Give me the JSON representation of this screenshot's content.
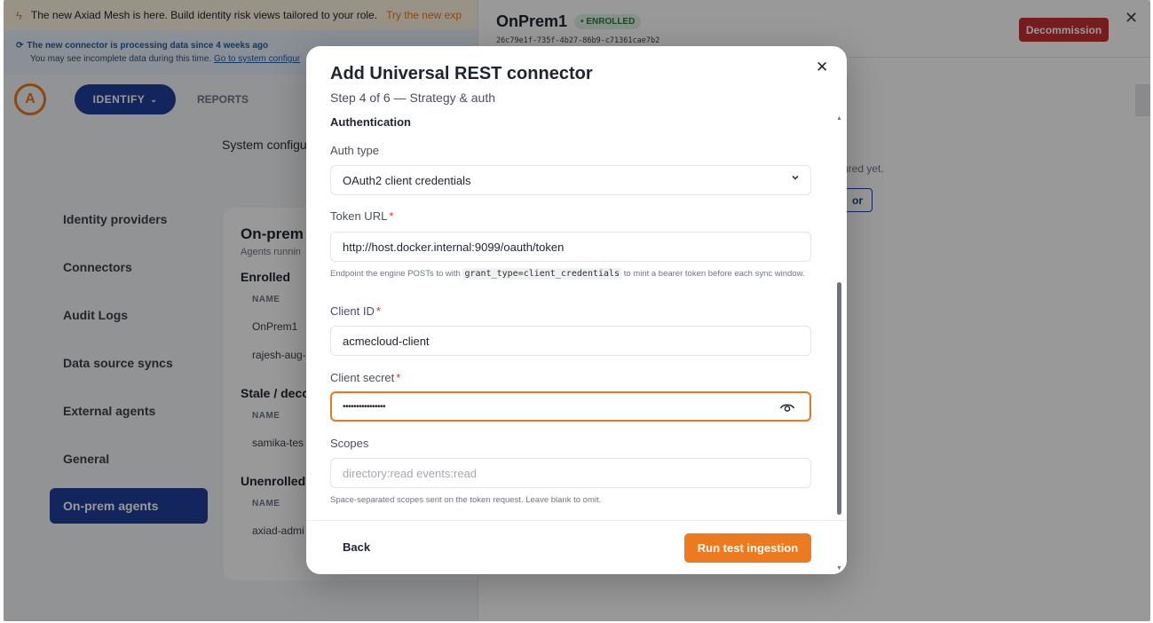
{
  "banner": {
    "text": "The new Axiad Mesh is here. Build identity risk views tailored to your role.",
    "link": "Try the new exp"
  },
  "notice": {
    "line1": "The new connector is processing data since 4 weeks ago",
    "line2": "You may see incomplete data during this time.",
    "link": "Go to system configur"
  },
  "nav": {
    "logo": "A",
    "identify": "IDENTIFY",
    "reports": "REPORTS"
  },
  "system_config": "System configu",
  "sidebar": {
    "items": [
      {
        "label": "Identity providers"
      },
      {
        "label": "Connectors"
      },
      {
        "label": "Audit Logs"
      },
      {
        "label": "Data source syncs"
      },
      {
        "label": "External agents"
      },
      {
        "label": "General"
      },
      {
        "label": "On-prem agents"
      }
    ]
  },
  "onprem": {
    "title": "On-prem",
    "subtitle": "Agents runnin",
    "enrolled": "Enrolled",
    "name_col": "NAME",
    "enrolled_rows": [
      "OnPrem1",
      "rajesh-aug-"
    ],
    "stale": "Stale / deco",
    "stale_rows": [
      "samika-tes"
    ],
    "unenrolled": "Unenrolled",
    "unenrolled_rows": [
      "axiad-admi"
    ]
  },
  "detail": {
    "title": "OnPrem1",
    "badge": "• ENROLLED",
    "id": "26c79e1f-735f-4b27-86b9-c71361cae7b2",
    "decommission": "Decommission",
    "empty_text": "ured yet.",
    "add_btn": "or"
  },
  "modal": {
    "title": "Add Universal REST connector",
    "step": "Step 4 of 6 — Strategy & auth",
    "section": "Authentication",
    "auth_type": {
      "label": "Auth type",
      "value": "OAuth2 client credentials"
    },
    "token_url": {
      "label": "Token URL",
      "required": "*",
      "value": "http://host.docker.internal:9099/oauth/token",
      "help_before": "Endpoint the engine POSTs to with",
      "help_code": "grant_type=client_credentials",
      "help_after": "to mint a bearer token before each sync window."
    },
    "client_id": {
      "label": "Client ID",
      "required": "*",
      "value": "acmecloud-client"
    },
    "client_secret": {
      "label": "Client secret",
      "required": "*",
      "value": "••••••••••••••••"
    },
    "scopes": {
      "label": "Scopes",
      "placeholder": "directory:read events:read",
      "help": "Space-separated scopes sent on the token request. Leave blank to omit."
    },
    "back": "Back",
    "run": "Run test ingestion"
  }
}
